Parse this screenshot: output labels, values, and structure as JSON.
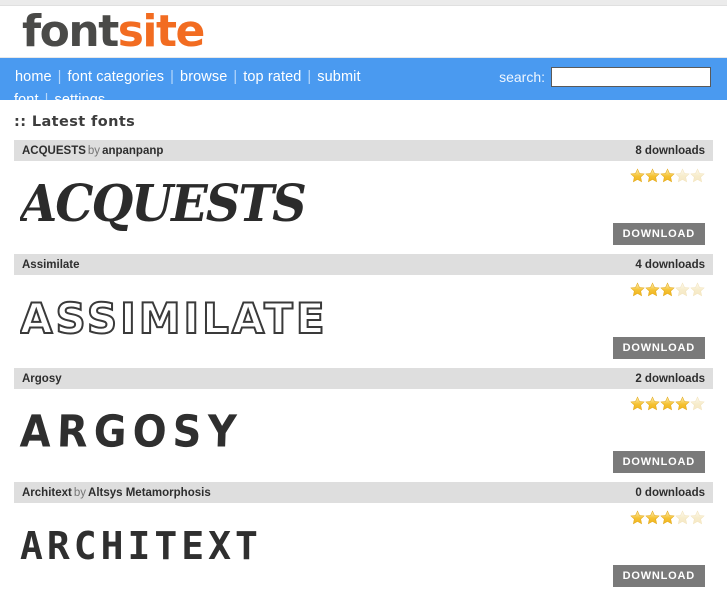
{
  "logo": {
    "part1": "font",
    "part2": "site"
  },
  "nav": {
    "items": [
      {
        "label": "home"
      },
      {
        "label": "font categories"
      },
      {
        "label": "browse"
      },
      {
        "label": "top rated"
      },
      {
        "label": "submit font"
      },
      {
        "label": "settings"
      }
    ],
    "separator": "|"
  },
  "search": {
    "label": "search:",
    "value": "",
    "placeholder": ""
  },
  "section": {
    "title": ":: Latest fonts"
  },
  "fonts": [
    {
      "name": "ACQUESTS",
      "by_label": "by",
      "author": "anpanpanp",
      "downloads": "8 downloads",
      "rating": 3,
      "max_rating": 5,
      "preview_text": "ACQUESTS",
      "download_label": "DOWNLOAD"
    },
    {
      "name": "Assimilate",
      "by_label": "",
      "author": "",
      "downloads": "4 downloads",
      "rating": 3,
      "max_rating": 5,
      "preview_text": "ASSIMILATE",
      "download_label": "DOWNLOAD"
    },
    {
      "name": "Argosy",
      "by_label": "",
      "author": "",
      "downloads": "2 downloads",
      "rating": 4,
      "max_rating": 5,
      "preview_text": "ARGOSY",
      "download_label": "DOWNLOAD"
    },
    {
      "name": "Architext",
      "by_label": "by",
      "author": "Altsys Metamorphosis",
      "downloads": "0 downloads",
      "rating": 3,
      "max_rating": 5,
      "preview_text": "ARCHITEXT",
      "download_label": "DOWNLOAD"
    }
  ],
  "colors": {
    "nav_background": "#4a9af0",
    "logo_accent": "#f26c21",
    "logo_dark": "#4a4a48",
    "item_header": "#dedede",
    "download_button": "#7a7a7a",
    "star_filled": "#f5c234",
    "star_empty": "#f7eccb"
  }
}
